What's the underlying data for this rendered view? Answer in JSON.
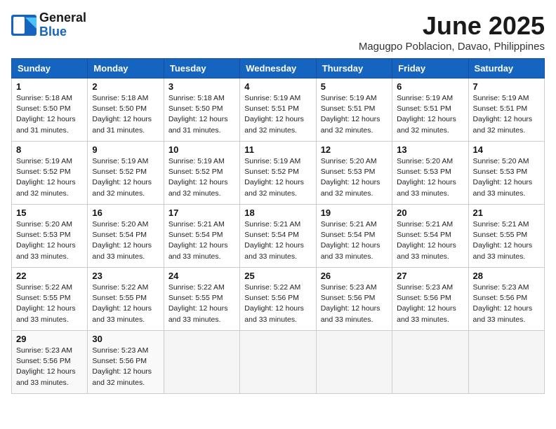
{
  "logo": {
    "line1": "General",
    "line2": "Blue"
  },
  "title": "June 2025",
  "location": "Magugpo Poblacion, Davao, Philippines",
  "weekdays": [
    "Sunday",
    "Monday",
    "Tuesday",
    "Wednesday",
    "Thursday",
    "Friday",
    "Saturday"
  ],
  "weeks": [
    [
      {
        "day": "1",
        "info": "Sunrise: 5:18 AM\nSunset: 5:50 PM\nDaylight: 12 hours\nand 31 minutes."
      },
      {
        "day": "2",
        "info": "Sunrise: 5:18 AM\nSunset: 5:50 PM\nDaylight: 12 hours\nand 31 minutes."
      },
      {
        "day": "3",
        "info": "Sunrise: 5:18 AM\nSunset: 5:50 PM\nDaylight: 12 hours\nand 31 minutes."
      },
      {
        "day": "4",
        "info": "Sunrise: 5:19 AM\nSunset: 5:51 PM\nDaylight: 12 hours\nand 32 minutes."
      },
      {
        "day": "5",
        "info": "Sunrise: 5:19 AM\nSunset: 5:51 PM\nDaylight: 12 hours\nand 32 minutes."
      },
      {
        "day": "6",
        "info": "Sunrise: 5:19 AM\nSunset: 5:51 PM\nDaylight: 12 hours\nand 32 minutes."
      },
      {
        "day": "7",
        "info": "Sunrise: 5:19 AM\nSunset: 5:51 PM\nDaylight: 12 hours\nand 32 minutes."
      }
    ],
    [
      {
        "day": "8",
        "info": "Sunrise: 5:19 AM\nSunset: 5:52 PM\nDaylight: 12 hours\nand 32 minutes."
      },
      {
        "day": "9",
        "info": "Sunrise: 5:19 AM\nSunset: 5:52 PM\nDaylight: 12 hours\nand 32 minutes."
      },
      {
        "day": "10",
        "info": "Sunrise: 5:19 AM\nSunset: 5:52 PM\nDaylight: 12 hours\nand 32 minutes."
      },
      {
        "day": "11",
        "info": "Sunrise: 5:19 AM\nSunset: 5:52 PM\nDaylight: 12 hours\nand 32 minutes."
      },
      {
        "day": "12",
        "info": "Sunrise: 5:20 AM\nSunset: 5:53 PM\nDaylight: 12 hours\nand 32 minutes."
      },
      {
        "day": "13",
        "info": "Sunrise: 5:20 AM\nSunset: 5:53 PM\nDaylight: 12 hours\nand 33 minutes."
      },
      {
        "day": "14",
        "info": "Sunrise: 5:20 AM\nSunset: 5:53 PM\nDaylight: 12 hours\nand 33 minutes."
      }
    ],
    [
      {
        "day": "15",
        "info": "Sunrise: 5:20 AM\nSunset: 5:53 PM\nDaylight: 12 hours\nand 33 minutes."
      },
      {
        "day": "16",
        "info": "Sunrise: 5:20 AM\nSunset: 5:54 PM\nDaylight: 12 hours\nand 33 minutes."
      },
      {
        "day": "17",
        "info": "Sunrise: 5:21 AM\nSunset: 5:54 PM\nDaylight: 12 hours\nand 33 minutes."
      },
      {
        "day": "18",
        "info": "Sunrise: 5:21 AM\nSunset: 5:54 PM\nDaylight: 12 hours\nand 33 minutes."
      },
      {
        "day": "19",
        "info": "Sunrise: 5:21 AM\nSunset: 5:54 PM\nDaylight: 12 hours\nand 33 minutes."
      },
      {
        "day": "20",
        "info": "Sunrise: 5:21 AM\nSunset: 5:54 PM\nDaylight: 12 hours\nand 33 minutes."
      },
      {
        "day": "21",
        "info": "Sunrise: 5:21 AM\nSunset: 5:55 PM\nDaylight: 12 hours\nand 33 minutes."
      }
    ],
    [
      {
        "day": "22",
        "info": "Sunrise: 5:22 AM\nSunset: 5:55 PM\nDaylight: 12 hours\nand 33 minutes."
      },
      {
        "day": "23",
        "info": "Sunrise: 5:22 AM\nSunset: 5:55 PM\nDaylight: 12 hours\nand 33 minutes."
      },
      {
        "day": "24",
        "info": "Sunrise: 5:22 AM\nSunset: 5:55 PM\nDaylight: 12 hours\nand 33 minutes."
      },
      {
        "day": "25",
        "info": "Sunrise: 5:22 AM\nSunset: 5:56 PM\nDaylight: 12 hours\nand 33 minutes."
      },
      {
        "day": "26",
        "info": "Sunrise: 5:23 AM\nSunset: 5:56 PM\nDaylight: 12 hours\nand 33 minutes."
      },
      {
        "day": "27",
        "info": "Sunrise: 5:23 AM\nSunset: 5:56 PM\nDaylight: 12 hours\nand 33 minutes."
      },
      {
        "day": "28",
        "info": "Sunrise: 5:23 AM\nSunset: 5:56 PM\nDaylight: 12 hours\nand 33 minutes."
      }
    ],
    [
      {
        "day": "29",
        "info": "Sunrise: 5:23 AM\nSunset: 5:56 PM\nDaylight: 12 hours\nand 33 minutes."
      },
      {
        "day": "30",
        "info": "Sunrise: 5:23 AM\nSunset: 5:56 PM\nDaylight: 12 hours\nand 32 minutes."
      },
      null,
      null,
      null,
      null,
      null
    ]
  ]
}
